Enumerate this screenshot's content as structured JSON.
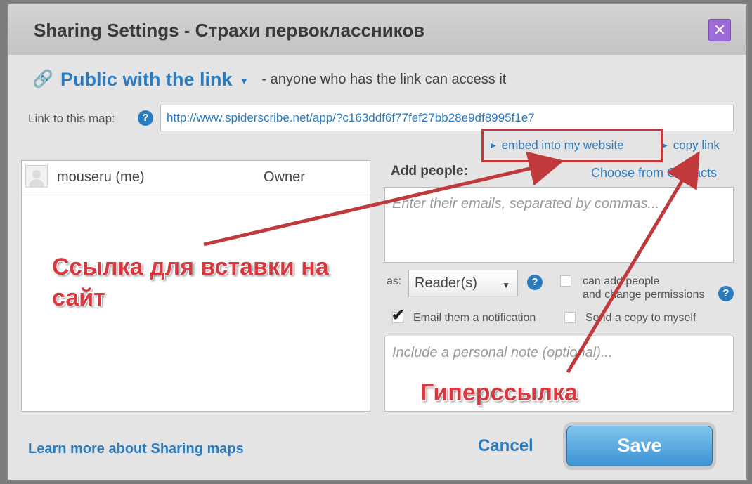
{
  "dialog": {
    "title": "Sharing Settings -  Страхи первоклассников",
    "close_icon": "close-x-icon"
  },
  "visibility": {
    "icon": "link-chain-icon",
    "mode": "Public with the link",
    "description": "- anyone who has the link can access it"
  },
  "link": {
    "label": "Link to this map:",
    "url": "http://www.spiderscribe.net/app/?c163ddf6f77fef27bb28e9df8995f1e7",
    "embed_label": "embed into my website",
    "copy_label": "copy link"
  },
  "people": {
    "rows": [
      {
        "name": "mouseru (me)",
        "role": "Owner"
      }
    ]
  },
  "add_people": {
    "label": "Add people:",
    "contacts_link": "Choose from Contacts",
    "emails_placeholder": "Enter their emails, separated by commas...",
    "as_label": "as:",
    "role_value": "Reader(s)",
    "can_add_label_1": "can add people",
    "can_add_label_2": "and change permissions",
    "can_add_checked": false,
    "notify_label": "Email them a notification",
    "notify_checked": true,
    "send_copy_label": "Send a copy to myself",
    "send_copy_checked": false,
    "note_placeholder": "Include a personal note (optional)..."
  },
  "footer": {
    "learn_more": "Learn more about Sharing maps",
    "cancel": "Cancel",
    "save": "Save"
  },
  "annotations": {
    "embed_note_line1": "Ссылка для вставки на",
    "embed_note_line2": "сайт",
    "hyperlink_note": "Гиперссылка",
    "color": "#d8383e"
  },
  "colors": {
    "accent": "#2b7bc0",
    "close_button": "#9b6ad6",
    "annotation_red": "#c0393b"
  }
}
